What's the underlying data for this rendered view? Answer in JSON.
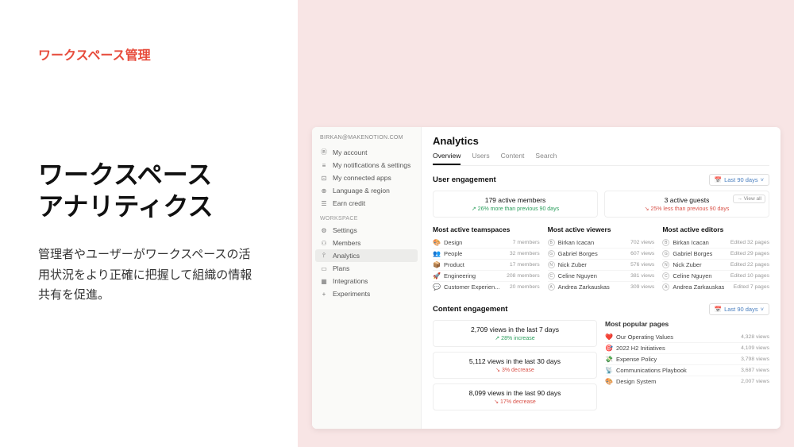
{
  "marketing": {
    "eyebrow": "ワークスペース管理",
    "headline_l1": "ワークスペース",
    "headline_l2": "アナリティクス",
    "body": "管理者やユーザーがワークスペースの活用状況をより正確に把握して組織の情報共有を促進。"
  },
  "sidebar": {
    "email": "BIRKAN@MAKENOTION.COM",
    "account": [
      {
        "icon": "Ⓑ",
        "label": "My account"
      },
      {
        "icon": "≡",
        "label": "My notifications & settings"
      },
      {
        "icon": "⊡",
        "label": "My connected apps"
      },
      {
        "icon": "⊕",
        "label": "Language & region"
      },
      {
        "icon": "☰",
        "label": "Earn credit"
      }
    ],
    "workspace_header": "WORKSPACE",
    "workspace": [
      {
        "icon": "⚙",
        "label": "Settings"
      },
      {
        "icon": "⚇",
        "label": "Members"
      },
      {
        "icon": "⫯",
        "label": "Analytics",
        "active": true
      },
      {
        "icon": "▭",
        "label": "Plans"
      },
      {
        "icon": "▦",
        "label": "Integrations"
      },
      {
        "icon": "+",
        "label": "Experiments"
      }
    ]
  },
  "main_title": "Analytics",
  "tabs": [
    "Overview",
    "Users",
    "Content",
    "Search"
  ],
  "user_eng": {
    "title": "User engagement",
    "filter": "Last 90 days",
    "members": {
      "main": "179 active members",
      "sub": "↗ 26% more than previous 90 days"
    },
    "guests": {
      "main": "3 active guests",
      "sub": "↘ 25% less than previous 90 days",
      "view_all": "→ View all"
    }
  },
  "teamspaces": {
    "title": "Most active teamspaces",
    "rows": [
      {
        "emoji": "🎨",
        "name": "Design",
        "val": "7 members"
      },
      {
        "emoji": "👥",
        "name": "People",
        "val": "32 members"
      },
      {
        "emoji": "📦",
        "name": "Product",
        "val": "17 members"
      },
      {
        "emoji": "🚀",
        "name": "Engineering",
        "val": "208 members"
      },
      {
        "emoji": "💬",
        "name": "Customer Experien...",
        "val": "20 members"
      }
    ]
  },
  "viewers": {
    "title": "Most active viewers",
    "rows": [
      {
        "name": "Birkan Icacan",
        "val": "702 views"
      },
      {
        "name": "Gabriel Borges",
        "val": "607 views"
      },
      {
        "name": "Nick Zuber",
        "val": "576 views"
      },
      {
        "name": "Celine Nguyen",
        "val": "381 views"
      },
      {
        "name": "Andrea Zarkauskas",
        "val": "309 views"
      }
    ]
  },
  "editors": {
    "title": "Most active editors",
    "rows": [
      {
        "name": "Birkan Icacan",
        "val": "Edited 32 pages"
      },
      {
        "name": "Gabriel Borges",
        "val": "Edited 29 pages"
      },
      {
        "name": "Nick Zuber",
        "val": "Edited 22 pages"
      },
      {
        "name": "Celine Nguyen",
        "val": "Edited 10 pages"
      },
      {
        "name": "Andrea Zarkauskas",
        "val": "Edited 7 pages"
      }
    ]
  },
  "content_eng": {
    "title": "Content engagement",
    "filter": "Last 90 days",
    "cards": [
      {
        "main": "2,709 views in the last 7 days",
        "sub": "↗ 28% increase",
        "cls": "pos"
      },
      {
        "main": "5,112 views in the last 30 days",
        "sub": "↘ 3% decrease",
        "cls": "neg"
      },
      {
        "main": "8,099 views in the last 90 days",
        "sub": "↘ 17% decrease",
        "cls": "neg"
      }
    ],
    "popular": {
      "title": "Most popular pages",
      "rows": [
        {
          "emoji": "❤️",
          "name": "Our Operating Values",
          "val": "4,328 views"
        },
        {
          "emoji": "🎯",
          "name": "2022 H2 Initiatives",
          "val": "4,109 views"
        },
        {
          "emoji": "💸",
          "name": "Expense Policy",
          "val": "3,798 views"
        },
        {
          "emoji": "📡",
          "name": "Communications Playbook",
          "val": "3,687 views"
        },
        {
          "emoji": "🎨",
          "name": "Design System",
          "val": "2,007 views"
        }
      ]
    }
  }
}
